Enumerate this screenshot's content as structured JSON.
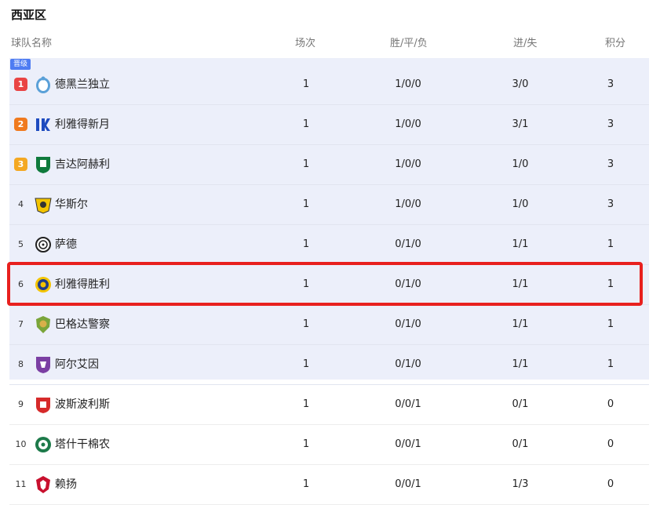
{
  "group_title": "西亚区",
  "columns": {
    "team": "球队名称",
    "played": "场次",
    "wdl": "胜/平/负",
    "goals": "进/失",
    "points": "积分"
  },
  "promotion_badge": "晋级",
  "colors": {
    "rank1": "#e94444",
    "rank2": "#f07a1f",
    "rank3": "#f4a823",
    "zone_bg": "#eceffa",
    "highlight": "#e8201e",
    "badge": "#4e7cf2"
  },
  "rows": [
    {
      "rank": "1",
      "team": "德黑兰独立",
      "played": "1",
      "wdl": "1/0/0",
      "goals": "3/0",
      "points": "3",
      "crest": "esteghlal-crest"
    },
    {
      "rank": "2",
      "team": "利雅得新月",
      "played": "1",
      "wdl": "1/0/0",
      "goals": "3/1",
      "points": "3",
      "crest": "al-hilal-crest"
    },
    {
      "rank": "3",
      "team": "吉达阿赫利",
      "played": "1",
      "wdl": "1/0/0",
      "goals": "1/0",
      "points": "3",
      "crest": "al-ahli-crest"
    },
    {
      "rank": "4",
      "team": "华斯尔",
      "played": "1",
      "wdl": "1/0/0",
      "goals": "1/0",
      "points": "3",
      "crest": "al-wasl-crest"
    },
    {
      "rank": "5",
      "team": "萨德",
      "played": "1",
      "wdl": "0/1/0",
      "goals": "1/1",
      "points": "1",
      "crest": "al-sadd-crest"
    },
    {
      "rank": "6",
      "team": "利雅得胜利",
      "played": "1",
      "wdl": "0/1/0",
      "goals": "1/1",
      "points": "1",
      "crest": "al-nassr-crest"
    },
    {
      "rank": "7",
      "team": "巴格达警察",
      "played": "1",
      "wdl": "0/1/0",
      "goals": "1/1",
      "points": "1",
      "crest": "al-shorta-crest"
    },
    {
      "rank": "8",
      "team": "阿尔艾因",
      "played": "1",
      "wdl": "0/1/0",
      "goals": "1/1",
      "points": "1",
      "crest": "al-ain-crest"
    },
    {
      "rank": "9",
      "team": "波斯波利斯",
      "played": "1",
      "wdl": "0/0/1",
      "goals": "0/1",
      "points": "0",
      "crest": "persepolis-crest"
    },
    {
      "rank": "10",
      "team": "塔什干棉农",
      "played": "1",
      "wdl": "0/0/1",
      "goals": "0/1",
      "points": "0",
      "crest": "pakhtakor-crest"
    },
    {
      "rank": "11",
      "team": "赖扬",
      "played": "1",
      "wdl": "0/0/1",
      "goals": "1/3",
      "points": "0",
      "crest": "al-rayyan-crest"
    }
  ]
}
